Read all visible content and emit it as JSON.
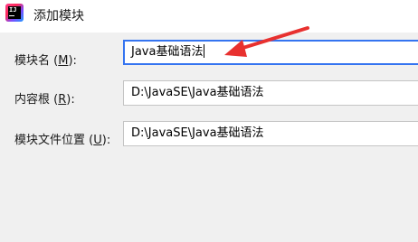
{
  "window": {
    "title": "添加模块",
    "icon": "intellij-idea-icon"
  },
  "form": {
    "module_name": {
      "label": "模块名",
      "mnemonic": "M",
      "value": "Java基础语法"
    },
    "content_root": {
      "label": "内容根",
      "mnemonic": "R",
      "value": "D:\\JavaSE\\Java基础语法"
    },
    "module_file_location": {
      "label": "模块文件位置",
      "mnemonic": "U",
      "value": "D:\\JavaSE\\Java基础语法"
    }
  },
  "annotation": {
    "type": "red-arrow",
    "color": "#e8312f",
    "points_to": "module-name-input"
  }
}
